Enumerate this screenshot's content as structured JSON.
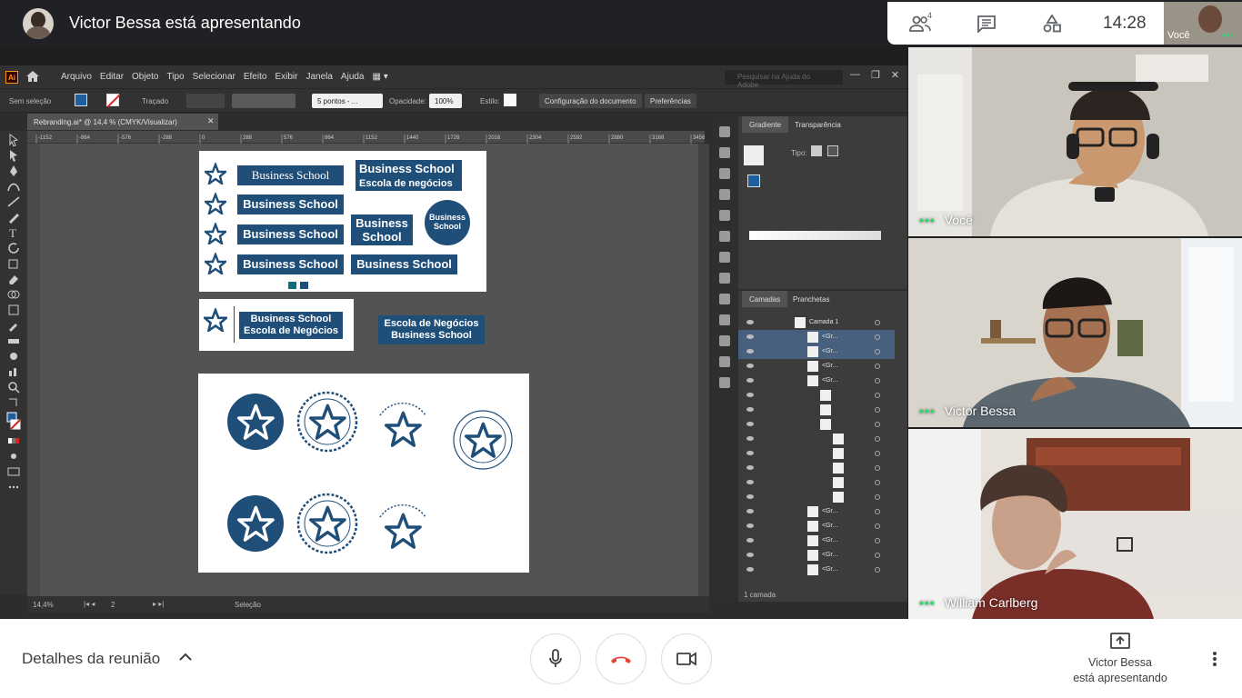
{
  "header": {
    "presenting_title": "Victor Bessa está apresentando",
    "participants_badge": "4",
    "clock": "14:28",
    "self_label": "Você"
  },
  "illustrator": {
    "menu": [
      "Arquivo",
      "Editar",
      "Objeto",
      "Tipo",
      "Selecionar",
      "Efeito",
      "Exibir",
      "Janela",
      "Ajuda"
    ],
    "search_placeholder": "Pesquisar na Ajuda do Adobe",
    "options": {
      "selection": "Sem seleção",
      "stroke_label": "Traçado",
      "points": "5 pontos - ...",
      "opacity_label": "Opacidade:",
      "opacity_value": "100%",
      "style_label": "Estilo:",
      "doc_setup_button": "Configuração do documento",
      "prefs_button": "Preferências"
    },
    "doc_tab": "Rebranding.ai* @ 14,4 % (CMYK/Visualizar)",
    "ruler_ticks": [
      "-1152",
      "-864",
      "-576",
      "-288",
      "0",
      "288",
      "576",
      "864",
      "1152",
      "1440",
      "1728",
      "2016",
      "2304",
      "2592",
      "2880",
      "3168",
      "3456"
    ],
    "artwork": {
      "brand_text": "Business School",
      "brand_text_line1": "Business",
      "brand_text_line2": "School",
      "school_pt": "Escola de negócios",
      "school_pt_cap": "Escola de Negócios",
      "round_logo_line1": "Business",
      "round_logo_line2": "School",
      "small_mark": "Business Escola"
    },
    "status": {
      "zoom": "14,4%",
      "artboard": "2",
      "mode": "Seleção"
    },
    "panels": {
      "gradient_tab": "Gradiente",
      "transparency_tab": "Transparência",
      "type_label": "Tipo:",
      "layers_tab": "Camadas",
      "artboards_tab": "Pranchetas",
      "layer_name": "Camada 1",
      "sublayer": "<Gr...",
      "layer_count": "1 camada"
    }
  },
  "participants": [
    {
      "name": "Você"
    },
    {
      "name": "Victor Bessa"
    },
    {
      "name": "William Carlberg"
    }
  ],
  "bottom": {
    "details": "Detalhes da reunião",
    "presenting_line1": "Victor Bessa",
    "presenting_line2": "está apresentando"
  },
  "colors": {
    "brand_blue": "#1f4e79",
    "meet_green": "#2fd76e",
    "hangup_red": "#ea4335"
  }
}
